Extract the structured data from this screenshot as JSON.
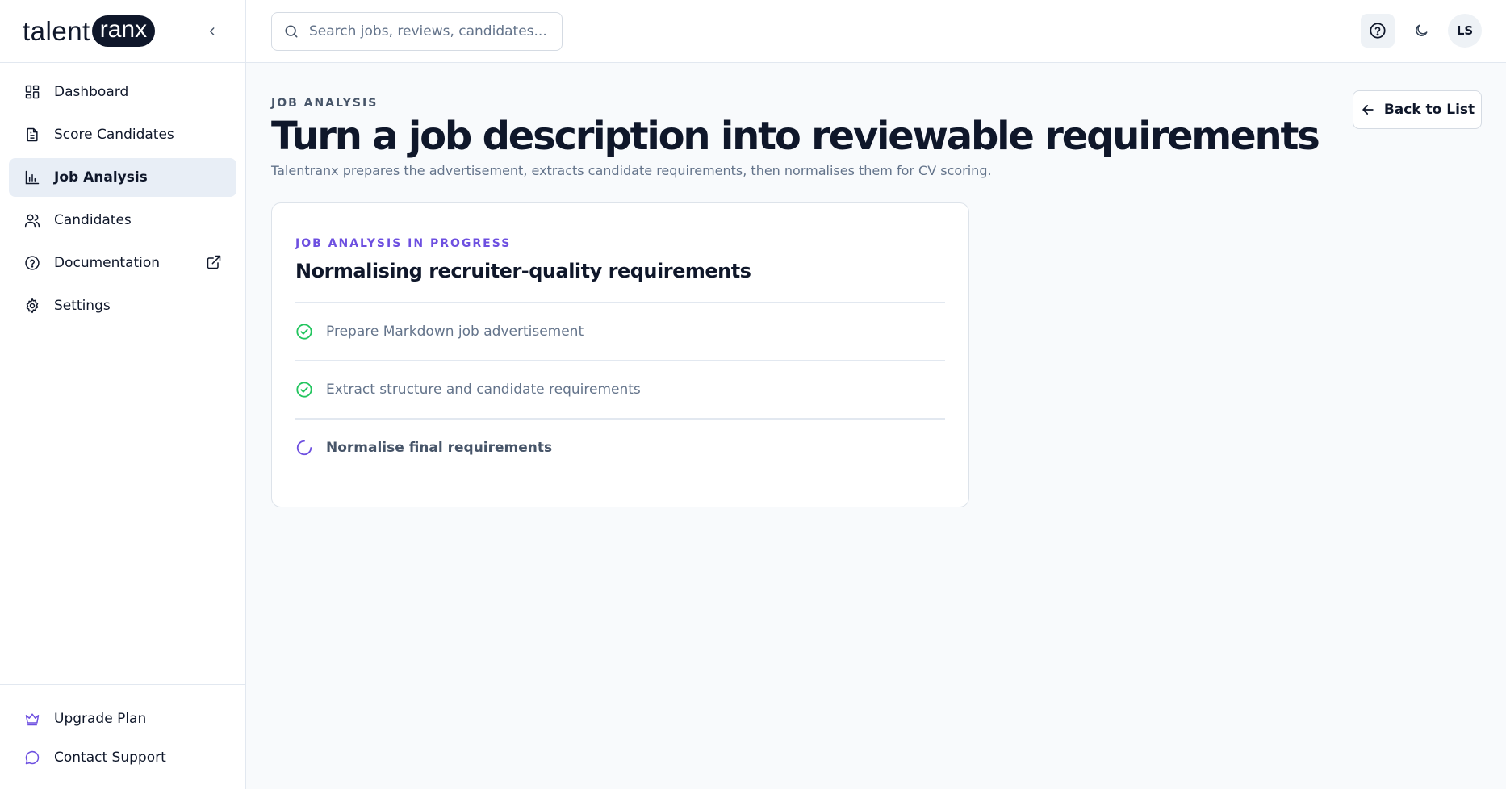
{
  "brand": {
    "part1": "talent",
    "part2": "ranx"
  },
  "sidebar": {
    "items": [
      {
        "label": "Dashboard",
        "icon": "dashboard-icon"
      },
      {
        "label": "Score Candidates",
        "icon": "document-icon"
      },
      {
        "label": "Job Analysis",
        "icon": "bar-chart-icon",
        "active": true
      },
      {
        "label": "Candidates",
        "icon": "users-icon"
      },
      {
        "label": "Documentation",
        "icon": "help-circle-icon",
        "external": true
      },
      {
        "label": "Settings",
        "icon": "gear-icon"
      }
    ],
    "bottom": [
      {
        "label": "Upgrade Plan",
        "icon": "crown-icon"
      },
      {
        "label": "Contact Support",
        "icon": "chat-bubble-icon"
      }
    ]
  },
  "topbar": {
    "search_placeholder": "Search jobs, reviews, candidates...",
    "avatar_initials": "LS"
  },
  "page": {
    "eyebrow": "JOB ANALYSIS",
    "title": "Turn a job description into reviewable requirements",
    "subtitle": "Talentranx prepares the advertisement, extracts candidate requirements, then normalises them for CV scoring.",
    "back_label": "Back to List"
  },
  "card": {
    "eyebrow": "JOB ANALYSIS IN PROGRESS",
    "title": "Normalising recruiter-quality requirements",
    "steps": [
      {
        "label": "Prepare Markdown job advertisement",
        "status": "done"
      },
      {
        "label": "Extract structure and candidate requirements",
        "status": "done"
      },
      {
        "label": "Normalise final requirements",
        "status": "in-progress"
      }
    ]
  },
  "colors": {
    "accent": "#6d4fe0",
    "success": "#22c55e",
    "text": "#0f172a",
    "muted": "#64748b"
  }
}
